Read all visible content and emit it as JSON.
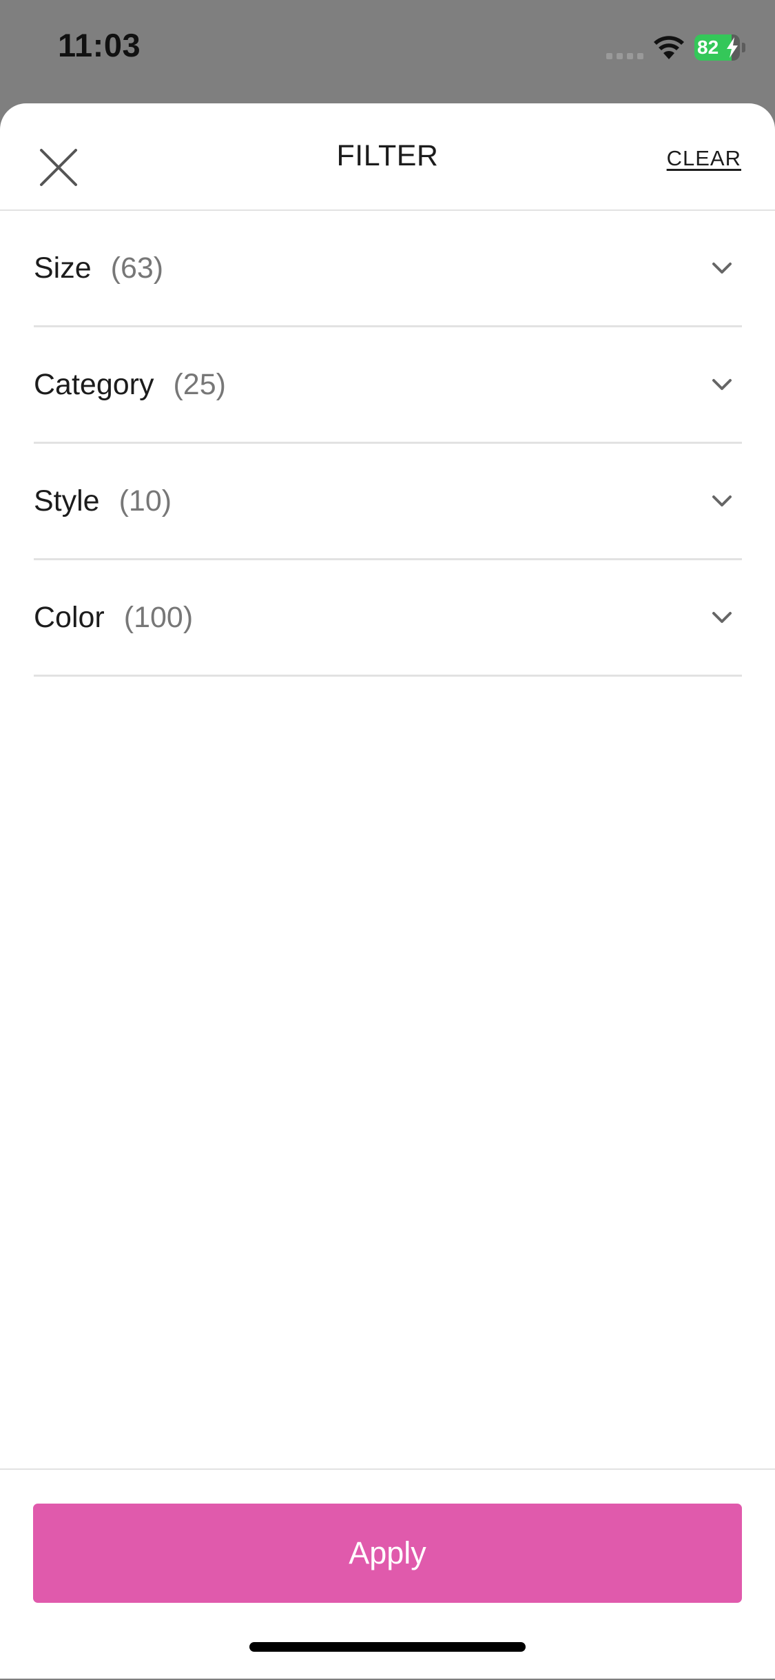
{
  "status_bar": {
    "time": "11:03",
    "battery_level": "82",
    "battery_fraction": 0.82,
    "battery_color": "#34c759",
    "icons": [
      "cell-signal-icon",
      "wifi-icon",
      "battery-icon",
      "charging-bolt-icon"
    ]
  },
  "header": {
    "title": "FILTER",
    "clear_label": "CLEAR",
    "close_icon": "close-icon"
  },
  "filters": [
    {
      "name": "Size",
      "count": "(63)",
      "icon": "chevron-down-icon"
    },
    {
      "name": "Category",
      "count": "(25)",
      "icon": "chevron-down-icon"
    },
    {
      "name": "Style",
      "count": "(10)",
      "icon": "chevron-down-icon"
    },
    {
      "name": "Color",
      "count": "(100)",
      "icon": "chevron-down-icon"
    }
  ],
  "footer": {
    "apply_label": "Apply",
    "apply_color": "#e05aac"
  }
}
